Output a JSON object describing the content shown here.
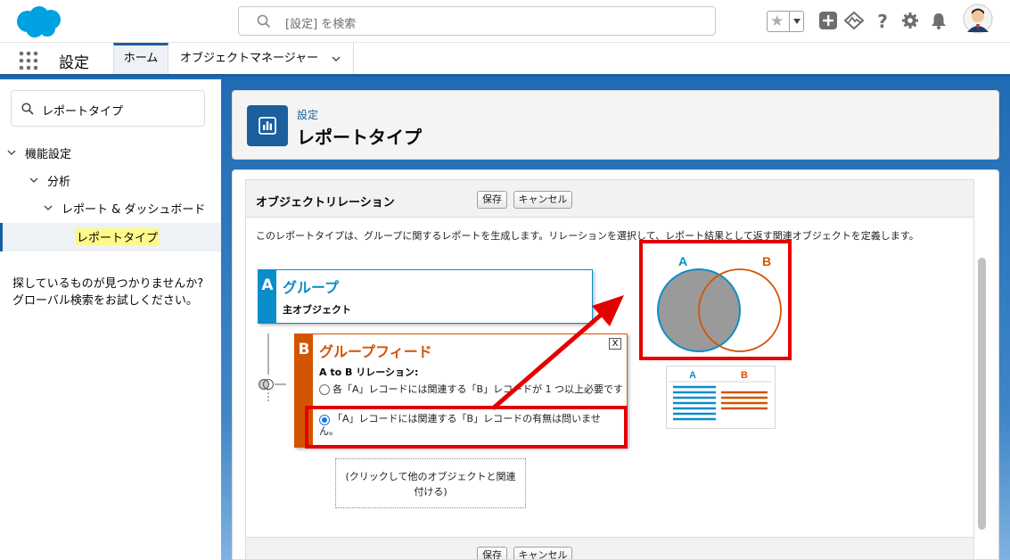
{
  "header": {
    "search_placeholder": "[設定] を検索",
    "icons": [
      "salesforce-logo",
      "search-icon",
      "favorites-star-icon",
      "chevron-down-icon",
      "plus-icon",
      "trailhead-icon",
      "help-icon",
      "gear-icon",
      "bell-icon",
      "avatar"
    ]
  },
  "nav": {
    "app_title": "設定",
    "tabs": [
      {
        "label": "ホーム",
        "active": true
      },
      {
        "label": "オブジェクトマネージャー",
        "active": false
      }
    ]
  },
  "sidebar": {
    "search_value": "レポートタイプ",
    "tree": [
      {
        "label": "機能設定",
        "level": 0
      },
      {
        "label": "分析",
        "level": 1
      },
      {
        "label": "レポート & ダッシュボード",
        "level": 2
      },
      {
        "label": "レポートタイプ",
        "level": 3,
        "active": true
      }
    ],
    "help_line1": "探しているものが見つかりませんか?",
    "help_line2": "グローバル検索をお試しください。"
  },
  "page_header": {
    "breadcrumb": "設定",
    "title": "レポートタイプ"
  },
  "section": {
    "title": "オブジェクトリレーション",
    "save_label": "保存",
    "cancel_label": "キャンセル",
    "description": "このレポートタイプは、グループに関するレポートを生成します。リレーションを選択して、レポート結果として返す関連オブジェクトを定義します。"
  },
  "object_a": {
    "tag": "A",
    "name": "グループ",
    "subtitle": "主オブジェクト"
  },
  "object_b": {
    "tag": "B",
    "name": "グループフィード",
    "close_label": "X",
    "relation_label": "A to B リレーション:",
    "options": [
      {
        "label": "各「A」レコードには関連する「B」レコードが 1 つ以上必要です",
        "selected": false
      },
      {
        "label": "「A」レコードには関連する「B」レコードの有無は問いません。",
        "selected": true
      }
    ]
  },
  "add_object": {
    "line1": "(クリックして他のオブジェクトと関連",
    "line2": "付ける)"
  },
  "venn": {
    "label_a": "A",
    "label_b": "B",
    "table_col_a": "A",
    "table_col_b": "B"
  },
  "colors": {
    "brand_blue": "#1b5f9e",
    "object_a": "#0b8dc9",
    "object_b": "#d35400",
    "highlight_red": "#e50000"
  }
}
